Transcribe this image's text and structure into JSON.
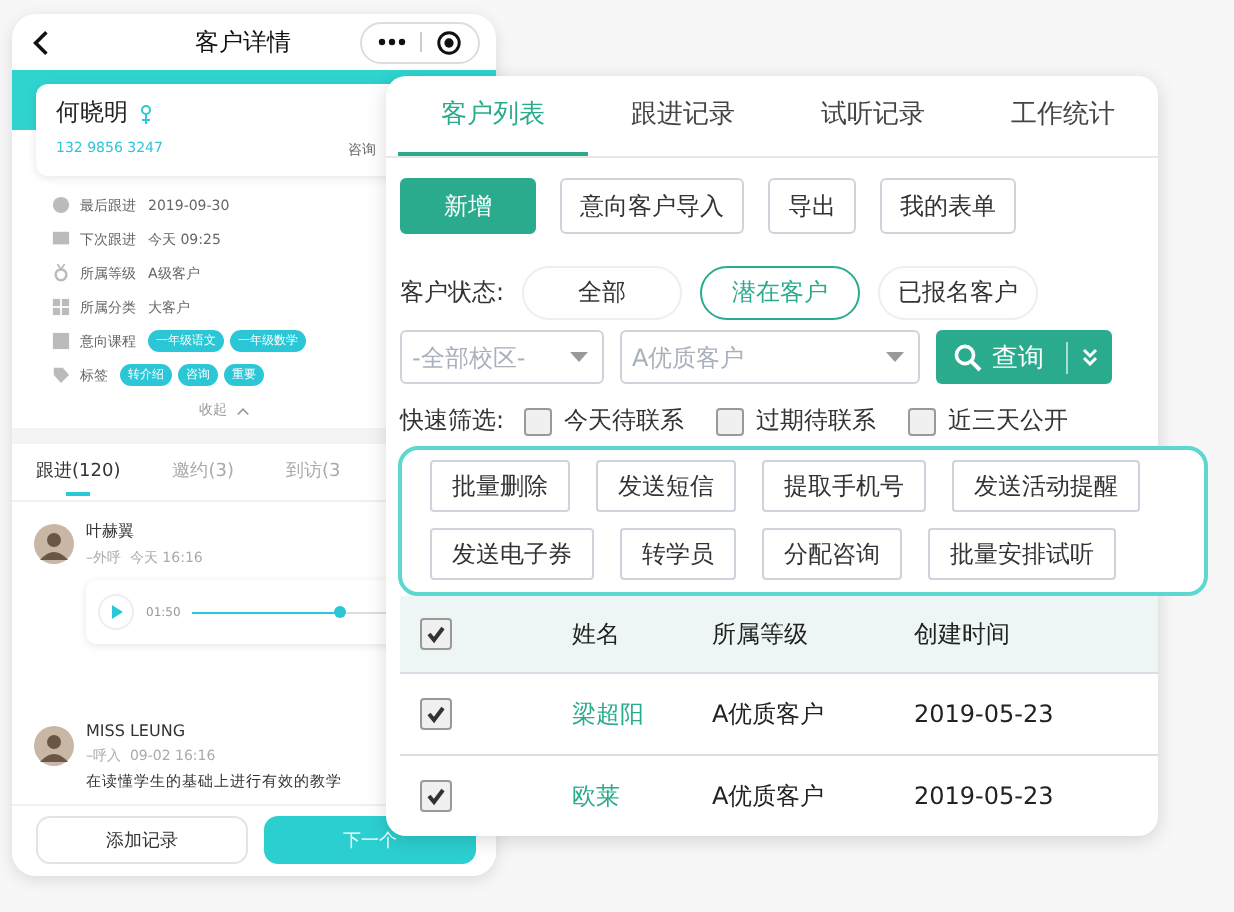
{
  "phone": {
    "title": "客户详情"
  },
  "customer": {
    "name": "何晓明",
    "phone": "132 9856 3247",
    "source": "咨询"
  },
  "details": [
    {
      "kind": "text",
      "label": "最后跟进",
      "value": "2019-09-30"
    },
    {
      "kind": "text",
      "label": "下次跟进",
      "value": "今天 09:25"
    },
    {
      "kind": "text",
      "label": "所属等级",
      "value": "A级客户"
    },
    {
      "kind": "text",
      "label": "所属分类",
      "value": "大客户"
    },
    {
      "kind": "tags",
      "label": "意向课程",
      "tags": [
        "一年级语文",
        "一年级数学"
      ]
    },
    {
      "kind": "tags",
      "label": "标签",
      "tags": [
        "转介绍",
        "咨询",
        "重要"
      ]
    }
  ],
  "collapse": "收起",
  "record_tabs": [
    {
      "label": "跟进(120)",
      "selected": true
    },
    {
      "label": "邀约(3)",
      "selected": false
    },
    {
      "label": "到访(3",
      "selected": false
    }
  ],
  "records": [
    {
      "kind": "audio",
      "name": "叶赫翼",
      "meta": "–外呼  今天 16:16",
      "time": "01:50",
      "level": 0.55
    },
    {
      "kind": "text",
      "name": "MISS LEUNG",
      "meta": "–呼入  09-02 16:16",
      "text": "在读懂学生的基础上进行有效的教学"
    }
  ],
  "footer_buttons": [
    {
      "label": "添加记录",
      "kind": "secondary"
    },
    {
      "label": "下一个",
      "kind": "primary"
    }
  ],
  "panel": {
    "tabs": [
      {
        "label": "客户列表",
        "selected": true
      },
      {
        "label": "跟进记录",
        "selected": false
      },
      {
        "label": "试听记录",
        "selected": false
      },
      {
        "label": "工作统计",
        "selected": false
      }
    ],
    "actions": [
      {
        "label": "新增",
        "kind": "primary"
      },
      {
        "label": "意向客户导入",
        "kind": "secondary"
      },
      {
        "label": "导出",
        "kind": "secondary"
      },
      {
        "label": "我的表单",
        "kind": "secondary"
      }
    ],
    "status_label": "客户状态:",
    "statuses": [
      {
        "label": "全部",
        "selected": false
      },
      {
        "label": "潜在客户",
        "selected": true
      },
      {
        "label": "已报名客户",
        "selected": false
      }
    ],
    "selects": [
      {
        "placeholder": "-全部校区-"
      },
      {
        "placeholder": "A优质客户"
      }
    ],
    "query_button": "查询",
    "quick_label": "快速筛选:",
    "quick_filters": [
      {
        "label": "今天待联系",
        "checked": false
      },
      {
        "label": "过期待联系",
        "checked": false
      },
      {
        "label": "近三天公开",
        "checked": false
      }
    ],
    "batch_actions": [
      [
        "批量删除",
        "发送短信",
        "提取手机号",
        "发送活动提醒"
      ],
      [
        "发送电子券",
        "转学员",
        "分配咨询",
        "批量安排试听"
      ]
    ],
    "table": {
      "header_checked": true,
      "columns": [
        "姓名",
        "所属等级",
        "创建时间"
      ],
      "rows": [
        {
          "checked": true,
          "cells": [
            "梁超阳",
            "A优质客户",
            "2019-05-23"
          ]
        },
        {
          "checked": true,
          "cells": [
            "欧莱",
            "A优质客户",
            "2019-05-23"
          ]
        }
      ]
    }
  }
}
